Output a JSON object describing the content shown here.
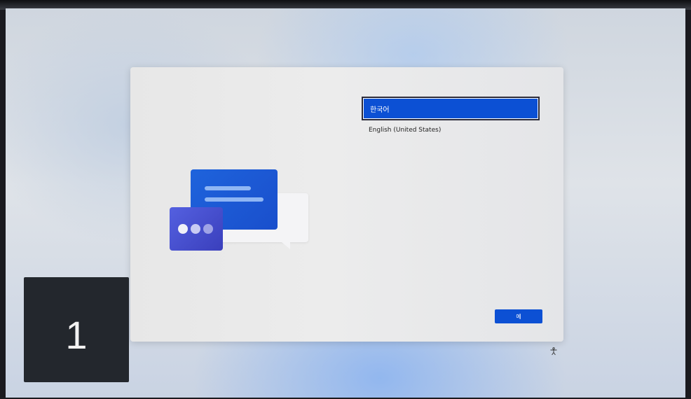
{
  "setup": {
    "languages": [
      {
        "label": "한국어",
        "selected": true
      },
      {
        "label": "English (United States)",
        "selected": false
      }
    ],
    "next_button_label": "예"
  },
  "overlay": {
    "counter": "1"
  },
  "icons": {
    "accessibility": "accessibility-icon",
    "illustration": "chat-bubbles-illustration"
  },
  "colors": {
    "accent": "#0c50d4"
  }
}
